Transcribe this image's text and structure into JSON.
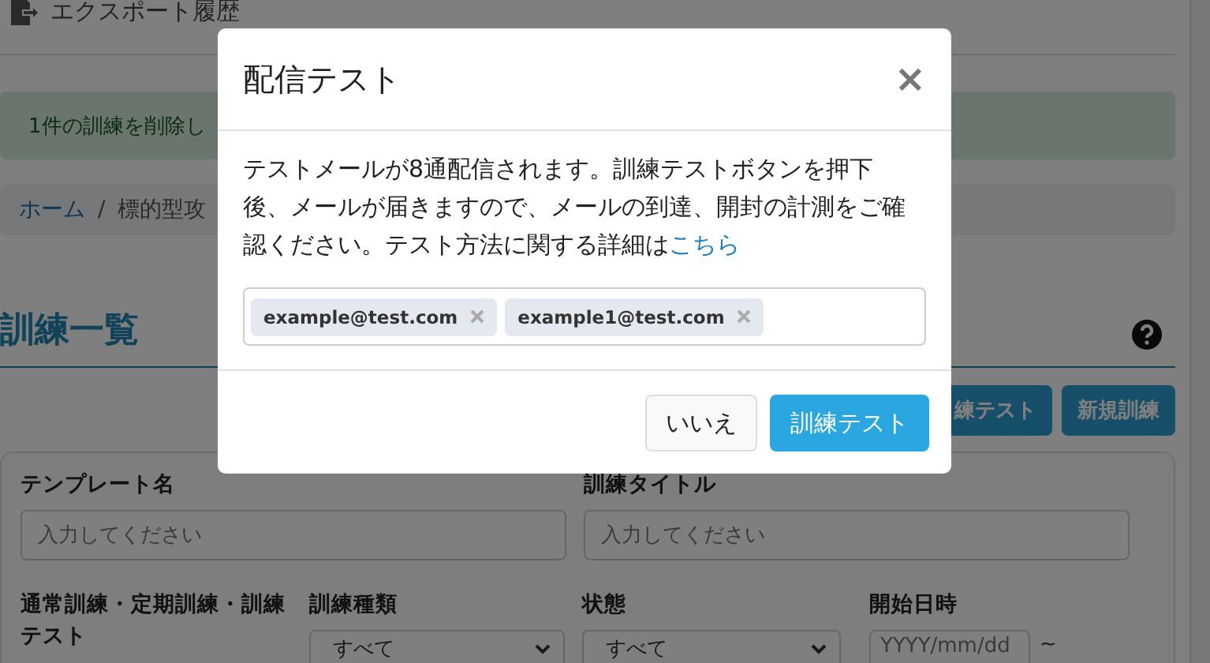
{
  "page": {
    "header": {
      "label": "エクスポート履歴"
    },
    "alert": "1件の訓練を削除し",
    "breadcrumb": {
      "separator": "/",
      "items": [
        {
          "label": "ホーム",
          "link": true
        },
        {
          "label": "標的型攻",
          "link": false
        }
      ]
    },
    "heading": "訓練一覧",
    "buttons": [
      "練テスト",
      "新規訓練"
    ],
    "filter_rows": [
      [
        {
          "kind": "text",
          "label": "テンプレート名",
          "placeholder": "入力してください"
        },
        {
          "kind": "text",
          "label": "訓練タイトル",
          "placeholder": "入力してください"
        }
      ],
      [
        {
          "kind": "label",
          "label": "通常訓練・定期訓練・訓練テスト"
        },
        {
          "kind": "select",
          "label": "訓練種類",
          "value": "すべて"
        },
        {
          "kind": "select",
          "label": "状態",
          "value": "すべて"
        },
        {
          "kind": "date",
          "label": "開始日時",
          "placeholder": "YYYY/mm/dd",
          "suffix": "~"
        }
      ]
    ]
  },
  "modal": {
    "title": "配信テスト",
    "close": "×",
    "message": "テストメールが8通配信されます。訓練テストボタンを押下後、メールが届きますので、メールの到達、開封の計測をご確認ください。テスト方法に関する詳細は",
    "link": "こちら",
    "tags": [
      {
        "label": "example@test.com"
      },
      {
        "label": "example1@test.com"
      }
    ],
    "buttons": [
      {
        "label": "いいえ",
        "kind": "secondary"
      },
      {
        "label": "訓練テスト",
        "kind": "primary"
      }
    ]
  }
}
